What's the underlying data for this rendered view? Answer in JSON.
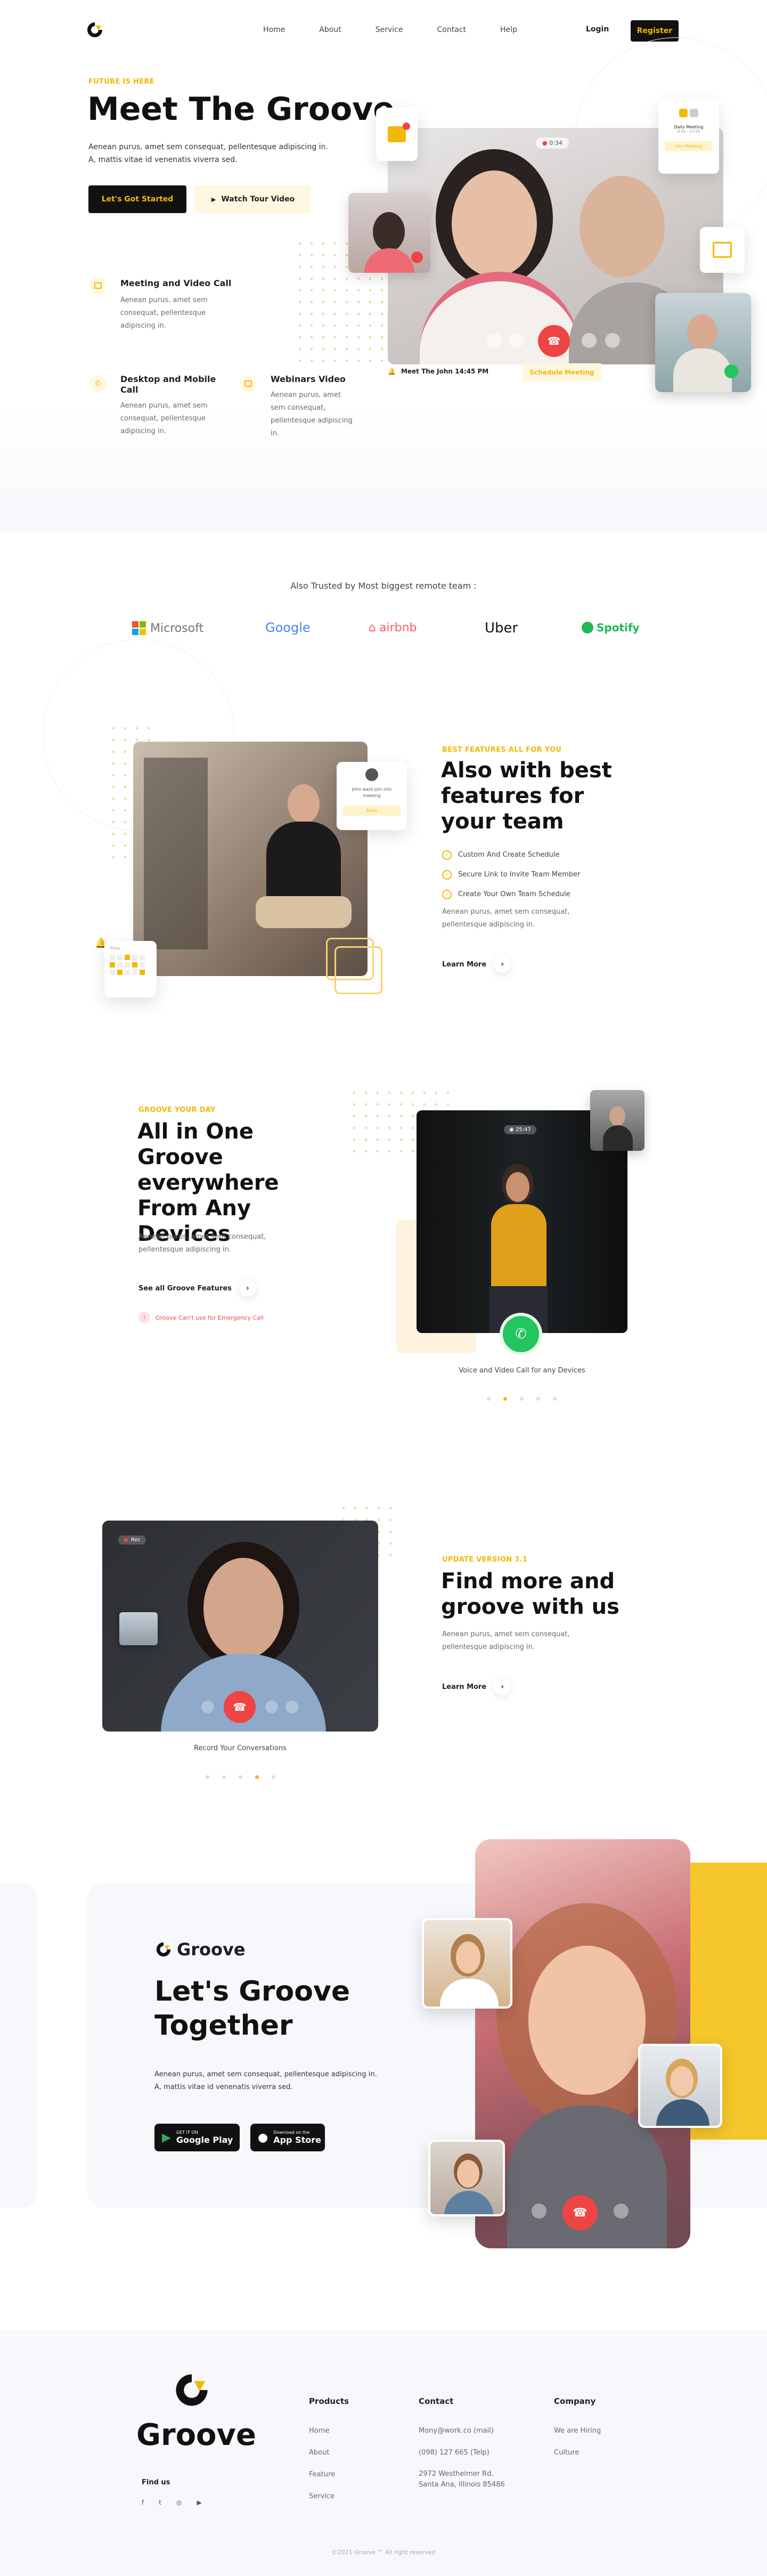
{
  "nav": {
    "items": [
      "Home",
      "About",
      "Service",
      "Contact",
      "Help"
    ],
    "login": "Login",
    "register": "Register"
  },
  "hero": {
    "eyebrow": "FUTURE IS HERE",
    "title": "Meet The Groove",
    "desc1": "Aenean purus, amet sem consequat, pellentesque adipiscing in.",
    "desc2": "A, mattis vitae id venenatis viverra sed.",
    "cta": "Let's Got Started",
    "tour": "Watch Tour Video",
    "features": [
      {
        "title": "Meeting and Video Call",
        "desc": "Aenean purus, amet sem consequat, pellentesque adipiscing in."
      },
      {
        "title": "Desktop and Mobile Call",
        "desc": "Aenean purus, amet sem consequat, pellentesque adipiscing in."
      },
      {
        "title": "Webinars Video",
        "desc": "Aenean purus, amet sem consequat, pellentesque adipiscing in."
      }
    ],
    "call_timer": "0:34",
    "meet_text": "Meet The John 14:45 PM",
    "schedule": "Schedule Meeting",
    "join_card_title": "Daily Meeting",
    "join_card_sub": "9:00 - 10:00",
    "join_btn": "Join Meeting"
  },
  "trusted": {
    "title": "Also Trusted by Most biggest remote team :",
    "logos": [
      "Microsoft",
      "Google",
      "airbnb",
      "Uber",
      "Spotify"
    ]
  },
  "features": {
    "eyebrow": "BEST FEATURES ALL FOR YOU",
    "title": "Also with best features for your team",
    "checks": [
      "Custom And Create Schedule",
      "Secure Link to Invite Team Member",
      "Create Your Own Team Schedule"
    ],
    "desc": "Aenean purus, amet sem consequat, pellentesque adipiscing in.",
    "learn": "Learn More",
    "card_text": "John want join into meeting",
    "card_btn": "Allow",
    "cal_label": "Today"
  },
  "groove": {
    "eyebrow": "GROOVE YOUR DAY",
    "title": "All in One Groove everywhere From Any Devices",
    "desc": "Aenean purus, amet sem consequat, pellentesque adipiscing in.",
    "btn": "See all Groove Features",
    "emergency": "Groove Can't use for Emergency Call",
    "timer": "25:47",
    "caption": "Voice and Video Call for any Devices"
  },
  "update": {
    "eyebrow": "UPDATE VERSION 3.1",
    "title": "Find more and groove with us",
    "desc": "Aenean purus, amet sem consequat, pellentesque adipiscing in.",
    "learn": "Learn More",
    "rec": "Rec",
    "caption": "Record Your Conversations"
  },
  "cta": {
    "brand": "Groove",
    "title": "Let's Groove Together",
    "desc1": "Aenean purus, amet sem consequat, pellentesque adipiscing in.",
    "desc2": "A, mattis vitae id venenatis viverra sed.",
    "google_small": "GET IT ON",
    "google": "Google Play",
    "apple_small": "Download on the",
    "apple": "App Store"
  },
  "footer": {
    "brand": "Groove",
    "find": "Find us",
    "cols": [
      {
        "title": "Products",
        "items": [
          "Home",
          "About",
          "Feature",
          "Service"
        ]
      },
      {
        "title": "Contact",
        "items": [
          "Mony@work.co (mail)",
          "(098) 127 665 (Telp)",
          "2972 Westheimer Rd.",
          "Santa Ana, Illinois 85486"
        ]
      },
      {
        "title": "Company",
        "items": [
          "We are Hiring",
          "Culture"
        ]
      }
    ],
    "copy": "©2021 Groove ™ All right reserved"
  },
  "colors": {
    "accent": "#f2b807",
    "red": "#ef4444",
    "green": "#22c55e"
  }
}
